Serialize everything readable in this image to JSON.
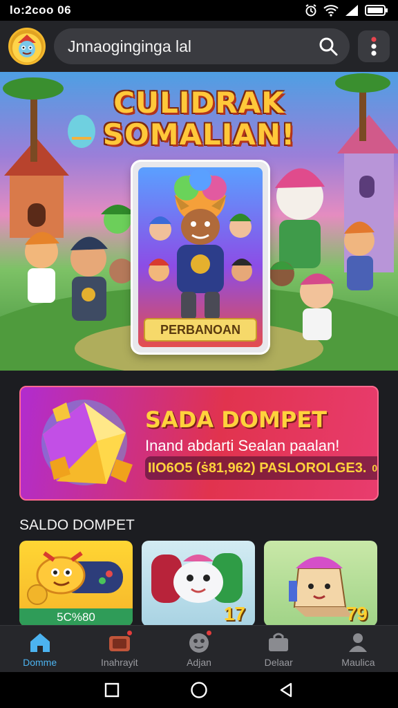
{
  "status_bar": {
    "time": "lo:2coo 06"
  },
  "header": {
    "search_text": "Jnnaogingingа lal",
    "icons": {
      "avatar": "mascot-avatar",
      "search": "search-icon",
      "menu": "more-vertical-icon"
    }
  },
  "hero": {
    "title_line1": "CULIDRAK",
    "title_line2": "SOMALIAN!",
    "card_label": "PERBANOAN"
  },
  "wallet_banner": {
    "title": "SADA DOMPET",
    "subtitle": "Inand abdarti Sealan paalan!",
    "amount": "IIO6O5 (ṡ81,962) PASLOROLGE3.",
    "amount_badge": "0"
  },
  "section": {
    "heading": "SALDO DOMPET"
  },
  "cards": [
    {
      "price": "5C%80",
      "price_style": "bar"
    },
    {
      "price": "17",
      "price_style": "corner"
    },
    {
      "price": "79",
      "price_style": "corner"
    }
  ],
  "bottom_nav": [
    {
      "label": "Domme",
      "icon": "home-icon",
      "active": true,
      "badge": false
    },
    {
      "label": "Inahrayit",
      "icon": "tv-icon",
      "active": false,
      "badge": true
    },
    {
      "label": "Adjan",
      "icon": "gamepad-icon",
      "active": false,
      "badge": true
    },
    {
      "label": "Delaar",
      "icon": "bag-icon",
      "active": false,
      "badge": false
    },
    {
      "label": "Maulica",
      "icon": "person-icon",
      "active": false,
      "badge": false
    }
  ],
  "colors": {
    "accent": "#4cb3f0",
    "banner_start": "#b12ccf",
    "banner_end": "#e83c6e",
    "gold": "#ffc83a"
  }
}
